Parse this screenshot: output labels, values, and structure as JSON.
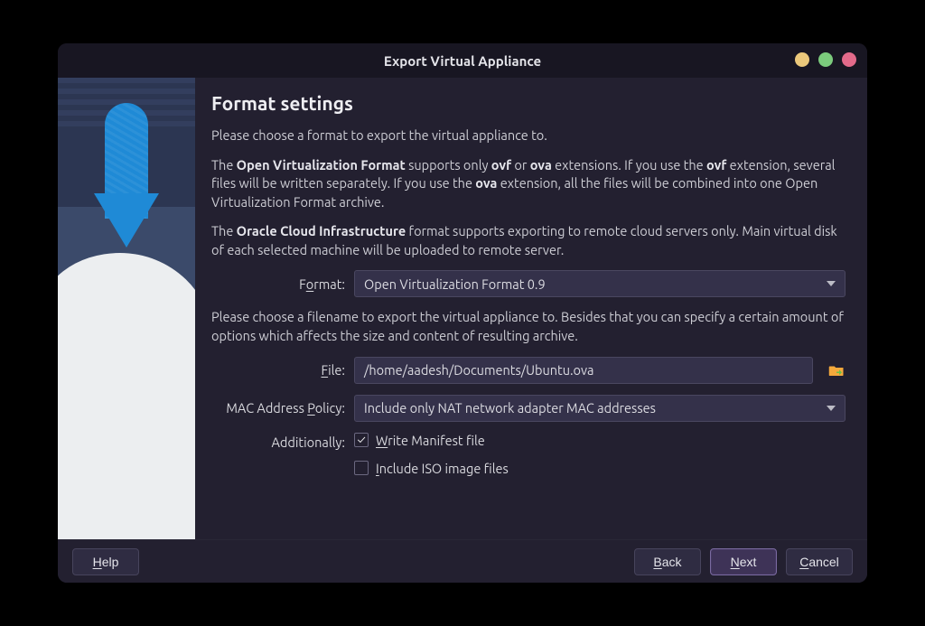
{
  "window": {
    "title": "Export Virtual Appliance"
  },
  "page": {
    "heading": "Format settings",
    "intro": "Please choose a format to export the virtual appliance to.",
    "ovf_para_1a": "The ",
    "ovf_para_bold1": "Open Virtualization Format",
    "ovf_para_1b": " supports only ",
    "ovf_para_bold2": "ovf",
    "ovf_para_1c": " or ",
    "ovf_para_bold3": "ova",
    "ovf_para_1d": " extensions. If you use the ",
    "ovf_para_bold4": "ovf",
    "ovf_para_1e": " extension, several files will be written separately. If you use the ",
    "ovf_para_bold5": "ova",
    "ovf_para_1f": " extension, all the files will be combined into one Open Virtualization Format archive.",
    "oci_para_1a": "The ",
    "oci_para_bold1": "Oracle Cloud Infrastructure",
    "oci_para_1b": " format supports exporting to remote cloud servers only. Main virtual disk of each selected machine will be uploaded to remote server.",
    "file_para": "Please choose a filename to export the virtual appliance to. Besides that you can specify a certain amount of options which affects the size and content of resulting archive."
  },
  "labels": {
    "format_pre": "F",
    "format_ul": "o",
    "format_post": "rmat:",
    "file_ul": "F",
    "file_post": "ile:",
    "mac_pre": "MAC Address ",
    "mac_ul": "P",
    "mac_post": "olicy:",
    "additionally": "Additionally:",
    "write_ul": "W",
    "write_post": "rite Manifest file",
    "include_ul": "I",
    "include_post": "nclude ISO image files"
  },
  "values": {
    "format": "Open Virtualization Format 0.9",
    "file": "/home/aadesh/Documents/Ubuntu.ova",
    "mac_policy": "Include only NAT network adapter MAC addresses"
  },
  "checks": {
    "write_manifest": true,
    "include_iso": false
  },
  "buttons": {
    "help_ul": "H",
    "help_post": "elp",
    "back_ul": "B",
    "back_post": "ack",
    "next_ul": "N",
    "next_post": "ext",
    "cancel_ul": "C",
    "cancel_post": "ancel"
  }
}
